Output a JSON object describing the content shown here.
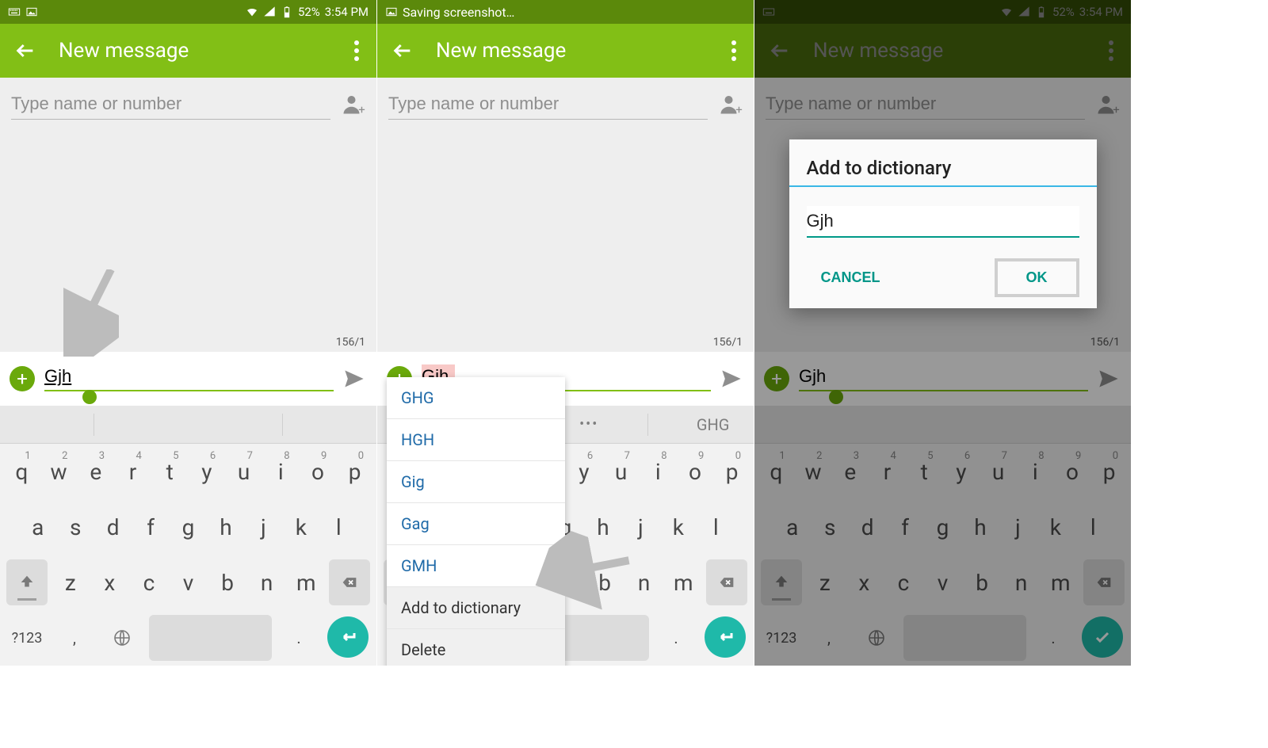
{
  "status": {
    "battery": "52%",
    "time": "3:54 PM",
    "saving": "Saving screenshot…"
  },
  "appbar": {
    "title": "New message"
  },
  "recipient": {
    "placeholder": "Type name or number"
  },
  "counter": "156/1",
  "compose": {
    "text": "Gjh"
  },
  "suggestions_panel2": [
    "Gig",
    "GHG"
  ],
  "context_menu": {
    "suggestions": [
      "GHG",
      "HGH",
      "Gig",
      "Gag",
      "GMH"
    ],
    "actions": [
      "Add to dictionary",
      "Delete"
    ]
  },
  "dialog": {
    "title": "Add to dictionary",
    "value": "Gjh",
    "cancel": "CANCEL",
    "ok": "OK"
  },
  "keyboard": {
    "row1": [
      "q",
      "w",
      "e",
      "r",
      "t",
      "y",
      "u",
      "i",
      "o",
      "p"
    ],
    "nums": [
      "1",
      "2",
      "3",
      "4",
      "5",
      "6",
      "7",
      "8",
      "9",
      "0"
    ],
    "row2": [
      "a",
      "s",
      "d",
      "f",
      "g",
      "h",
      "j",
      "k",
      "l"
    ],
    "row3": [
      "z",
      "x",
      "c",
      "v",
      "b",
      "n",
      "m"
    ],
    "num_label": "?123",
    "comma": ",",
    "period": "."
  }
}
